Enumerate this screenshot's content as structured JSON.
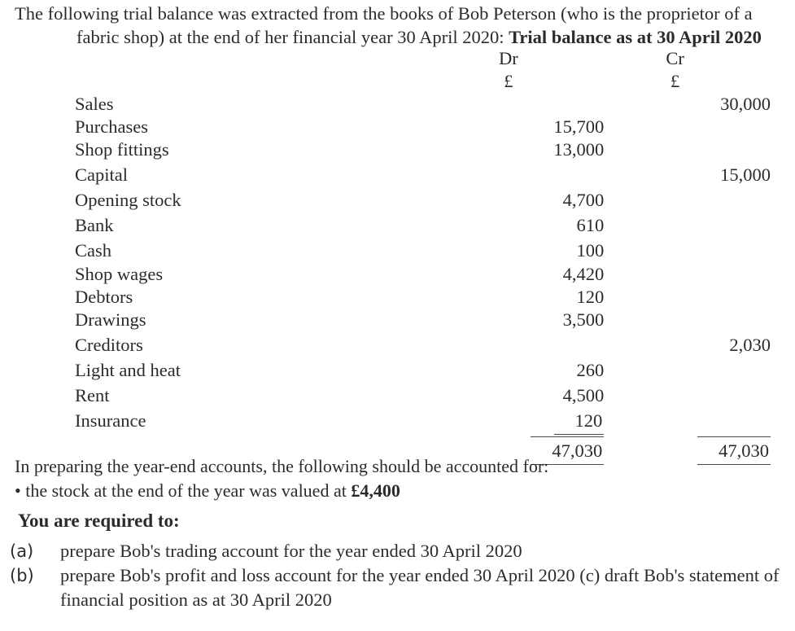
{
  "intro": {
    "line1": "The following trial balance was extracted from the books of Bob Peterson (who is the proprietor of a",
    "line2_plain": "fabric shop) at the end of her financial year 30 April 2020: ",
    "line2_bold": "Trial balance as at 30 April 2020"
  },
  "table": {
    "headers": {
      "label": "",
      "dr": "Dr",
      "cr": "Cr",
      "dr_currency": "£",
      "cr_currency": "£"
    },
    "rows": [
      {
        "label": "Sales",
        "dr": "",
        "cr": "30,000"
      },
      {
        "label": "Purchases",
        "dr": "15,700",
        "cr": ""
      },
      {
        "label": "Shop fittings",
        "dr": "13,000",
        "cr": ""
      },
      {
        "label": "Capital",
        "dr": "",
        "cr": "15,000"
      },
      {
        "label": "Opening stock",
        "dr": "4,700",
        "cr": ""
      },
      {
        "label": "Bank",
        "dr": "610",
        "cr": ""
      },
      {
        "label": "Cash",
        "dr": "100",
        "cr": ""
      },
      {
        "label": "Shop wages",
        "dr": "4,420",
        "cr": ""
      },
      {
        "label": "Debtors",
        "dr": "120",
        "cr": ""
      },
      {
        "label": "Drawings",
        "dr": "3,500",
        "cr": ""
      },
      {
        "label": "Creditors",
        "dr": "",
        "cr": "2,030"
      },
      {
        "label": "Light and heat",
        "dr": "260",
        "cr": ""
      },
      {
        "label": "Rent",
        "dr": "4,500",
        "cr": ""
      },
      {
        "label": "Insurance",
        "dr": "120",
        "cr": ""
      }
    ],
    "totals": {
      "label": "",
      "dr": "47,030",
      "cr": "47,030"
    }
  },
  "notes": {
    "intro": "In preparing the year-end accounts, the following should be accounted for:",
    "bullet_symbol": "•",
    "bullet_text_plain": " the stock at the end of the year was valued at ",
    "bullet_text_bold": "£4,400"
  },
  "required": {
    "title": "You are required to:",
    "tasks": [
      {
        "marker": "(a)",
        "text": "prepare Bob's trading account for the year ended 30 April 2020"
      },
      {
        "marker": "(b)",
        "text": "prepare Bob's profit and loss account for the year ended 30 April 2020 (c) draft Bob's statement of financial position as at 30 April 2020"
      }
    ]
  },
  "colors": {
    "background": "#ffffff",
    "text": "#2b2b2b",
    "rule": "#4a4a4a"
  }
}
